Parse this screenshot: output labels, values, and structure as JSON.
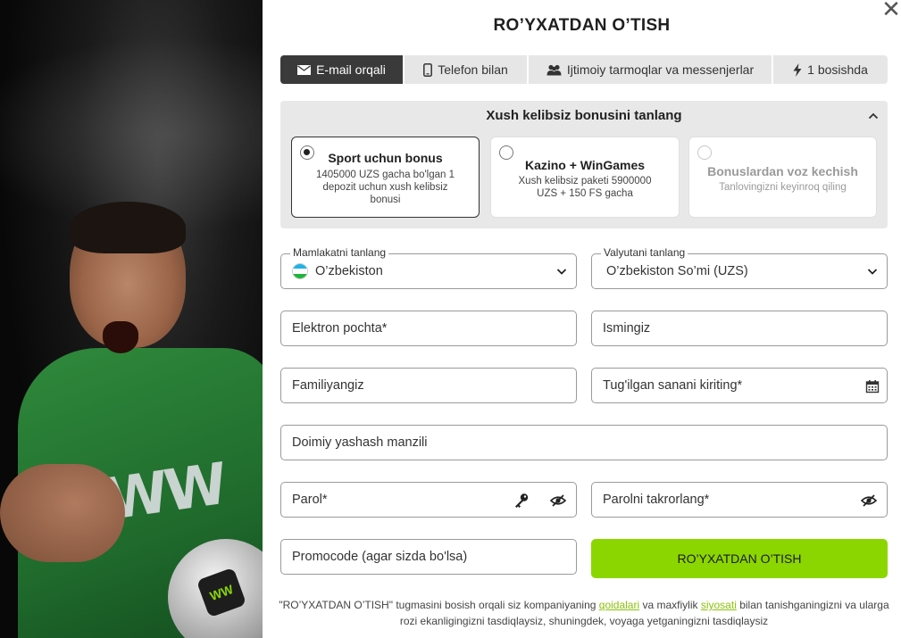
{
  "title": "RO’YXATDAN O’TISH",
  "tabs": [
    {
      "label": "E-mail orqali",
      "icon": "envelope-icon",
      "active": true
    },
    {
      "label": "Telefon bilan",
      "icon": "phone-icon"
    },
    {
      "label": "Ijtimoiy tarmoqlar va messenjerlar",
      "icon": "users-icon"
    },
    {
      "label": "1 bosishda",
      "icon": "lightning-icon"
    }
  ],
  "bonus": {
    "heading": "Xush kelibsiz bonusini tanlang",
    "options": [
      {
        "title": "Sport uchun bonus",
        "subtitle": "1405000 UZS gacha bo'lgan 1 depozit uchun xush kelibsiz bonusi",
        "selected": true
      },
      {
        "title": "Kazino + WinGames",
        "subtitle": "Xush kelibsiz paketi 5900000 UZS + 150 FS gacha",
        "selected": false
      },
      {
        "title": "Bonuslardan voz kechish",
        "subtitle": "Tanlovingizni keyinroq qiling",
        "selected": false
      }
    ]
  },
  "form": {
    "country_label": "Mamlakatni tanlang",
    "country_value": "O’zbekiston",
    "currency_label": "Valyutani tanlang",
    "currency_value": "O’zbekiston So’mi (UZS)",
    "email_placeholder": "Elektron pochta*",
    "name_placeholder": "Ismingiz",
    "surname_placeholder": "Familiyangiz",
    "birthdate_placeholder": "Tug'ilgan sanani kiriting*",
    "address_placeholder": "Doimiy yashash manzili",
    "password_placeholder": "Parol*",
    "password_repeat_placeholder": "Parolni takrorlang*",
    "promo_placeholder": "Promocode (agar sizda bo'lsa)",
    "submit_label": "RO’YXATDAN O’TISH"
  },
  "terms": {
    "part1": "\"RO’YXATDAN O’TISH\" tugmasini bosish orqali siz kompaniyaning ",
    "link1": "qoidalari",
    "part2": " va maxfiylik ",
    "link2": "siyosati",
    "part3": " bilan tanishganingizni va ularga rozi ekanligingizni tasdiqlaysiz, shuningdek, voyaga yetganingizni tasdiqlaysiz"
  },
  "hero": {
    "shirt_logo": "WW",
    "ball_logo": "WW"
  },
  "colors": {
    "accent": "#8cd600",
    "active_tab": "#3a3a3a",
    "link": "#8cc20a"
  }
}
